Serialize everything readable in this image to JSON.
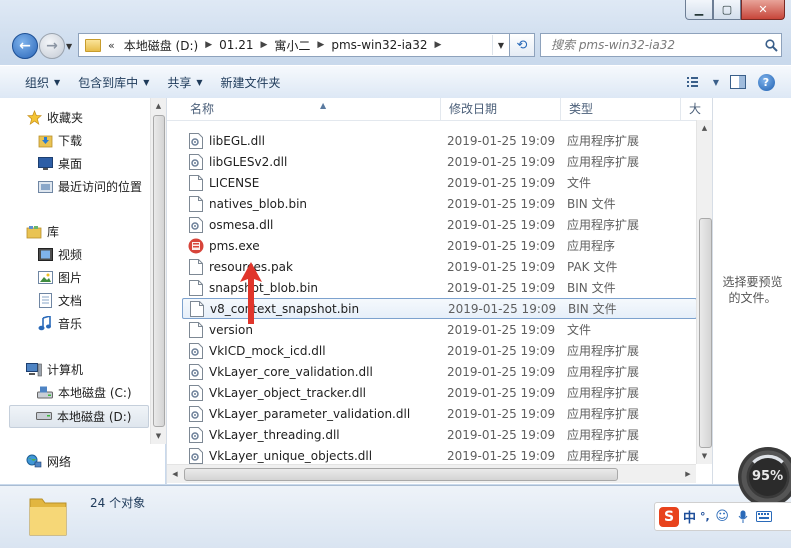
{
  "address": {
    "more": "«",
    "crumbs": [
      "本地磁盘 (D:)",
      "01.21",
      "寓小二",
      "pms-win32-ia32"
    ]
  },
  "search": {
    "placeholder": "搜索 pms-win32-ia32"
  },
  "toolbar": {
    "organize": "组织",
    "include_library": "包含到库中",
    "share": "共享",
    "new_folder": "新建文件夹"
  },
  "nav": {
    "favorites": "收藏夹",
    "downloads": "下载",
    "desktop": "桌面",
    "recent": "最近访问的位置",
    "libraries": "库",
    "videos": "视频",
    "pictures": "图片",
    "documents": "文档",
    "music": "音乐",
    "computer": "计算机",
    "drive_c": "本地磁盘 (C:)",
    "drive_d": "本地磁盘 (D:)",
    "network": "网络"
  },
  "columns": {
    "name": "名称",
    "date": "修改日期",
    "type": "类型",
    "size": "大"
  },
  "files": [
    {
      "name": "libEGL.dll",
      "date": "2019-01-25 19:09",
      "type": "应用程序扩展",
      "icon": "dll"
    },
    {
      "name": "libGLESv2.dll",
      "date": "2019-01-25 19:09",
      "type": "应用程序扩展",
      "icon": "dll"
    },
    {
      "name": "LICENSE",
      "date": "2019-01-25 19:09",
      "type": "文件",
      "icon": "file"
    },
    {
      "name": "natives_blob.bin",
      "date": "2019-01-25 19:09",
      "type": "BIN 文件",
      "icon": "file"
    },
    {
      "name": "osmesa.dll",
      "date": "2019-01-25 19:09",
      "type": "应用程序扩展",
      "icon": "dll"
    },
    {
      "name": "pms.exe",
      "date": "2019-01-25 19:09",
      "type": "应用程序",
      "icon": "exe"
    },
    {
      "name": "resources.pak",
      "date": "2019-01-25 19:09",
      "type": "PAK 文件",
      "icon": "file"
    },
    {
      "name": "snapshot_blob.bin",
      "date": "2019-01-25 19:09",
      "type": "BIN 文件",
      "icon": "file"
    },
    {
      "name": "v8_context_snapshot.bin",
      "date": "2019-01-25 19:09",
      "type": "BIN 文件",
      "icon": "file"
    },
    {
      "name": "version",
      "date": "2019-01-25 19:09",
      "type": "文件",
      "icon": "file"
    },
    {
      "name": "VkICD_mock_icd.dll",
      "date": "2019-01-25 19:09",
      "type": "应用程序扩展",
      "icon": "dll"
    },
    {
      "name": "VkLayer_core_validation.dll",
      "date": "2019-01-25 19:09",
      "type": "应用程序扩展",
      "icon": "dll"
    },
    {
      "name": "VkLayer_object_tracker.dll",
      "date": "2019-01-25 19:09",
      "type": "应用程序扩展",
      "icon": "dll"
    },
    {
      "name": "VkLayer_parameter_validation.dll",
      "date": "2019-01-25 19:09",
      "type": "应用程序扩展",
      "icon": "dll"
    },
    {
      "name": "VkLayer_threading.dll",
      "date": "2019-01-25 19:09",
      "type": "应用程序扩展",
      "icon": "dll"
    },
    {
      "name": "VkLayer_unique_objects.dll",
      "date": "2019-01-25 19:09",
      "type": "应用程序扩展",
      "icon": "dll"
    }
  ],
  "preview": {
    "line1": "选择要预览",
    "line2": "的文件。"
  },
  "status": {
    "count": "24 个对象"
  },
  "overlay": {
    "gauge": "95%"
  },
  "ime": {
    "mode": "中",
    "punct": "°,"
  },
  "colors": {
    "arrow": "#e0352b",
    "accent": "#2a66b8"
  }
}
